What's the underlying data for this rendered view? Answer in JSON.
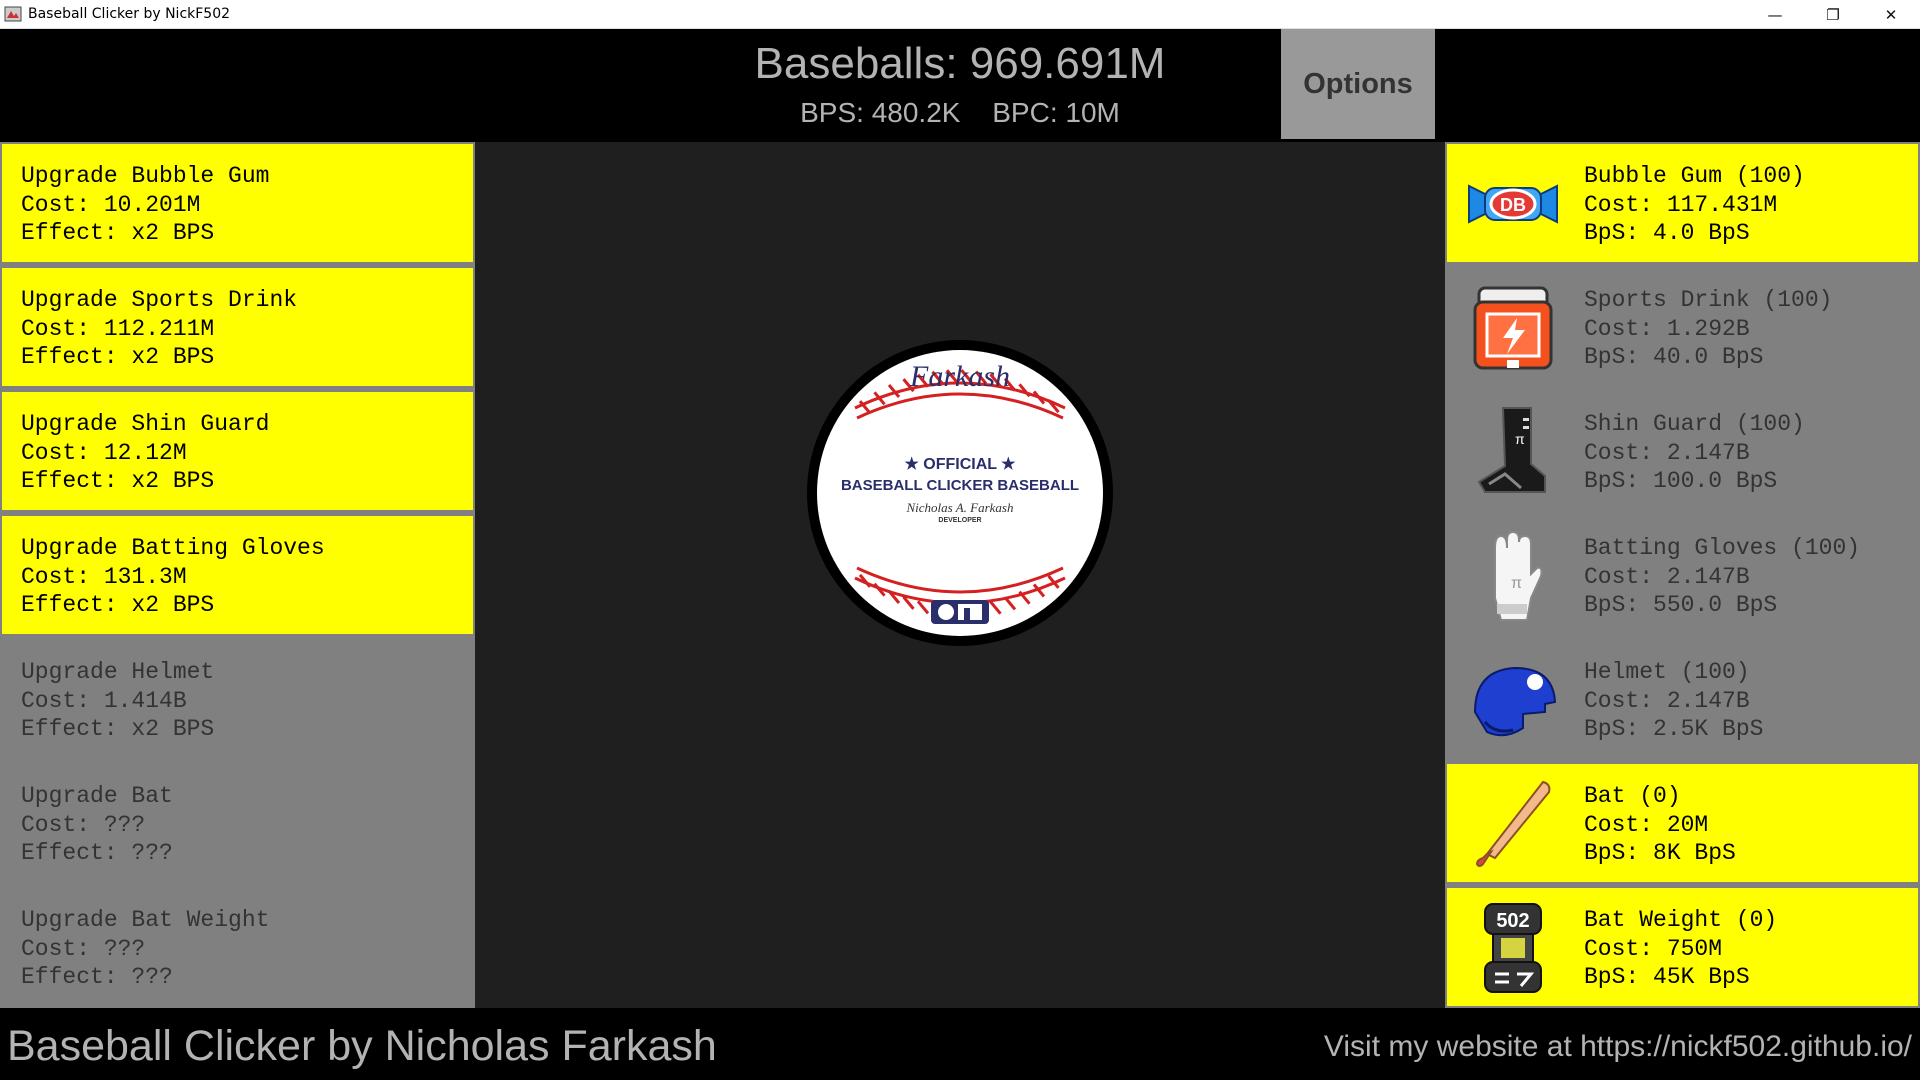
{
  "window": {
    "title": "Baseball Clicker by NickF502",
    "minimize": "—",
    "maximize": "❐",
    "close": "✕"
  },
  "header": {
    "baseballs": "Baseballs: 969.691M",
    "bps": "BPS: 480.2K",
    "bpc": "BPC: 10M",
    "options_label": "Options"
  },
  "upgrades": [
    {
      "name": "Upgrade Bubble Gum",
      "cost": "Cost: 10.201M",
      "effect": "Effect: x2 BPS",
      "affordable": true
    },
    {
      "name": "Upgrade Sports Drink",
      "cost": "Cost: 112.211M",
      "effect": "Effect: x2 BPS",
      "affordable": true
    },
    {
      "name": "Upgrade Shin Guard",
      "cost": "Cost: 12.12M",
      "effect": "Effect: x2 BPS",
      "affordable": true
    },
    {
      "name": "Upgrade Batting Gloves",
      "cost": "Cost: 131.3M",
      "effect": "Effect: x2 BPS",
      "affordable": true
    },
    {
      "name": "Upgrade Helmet",
      "cost": "Cost: 1.414B",
      "effect": "Effect: x2 BPS",
      "affordable": false
    },
    {
      "name": "Upgrade Bat",
      "cost": "Cost: ???",
      "effect": "Effect: ???",
      "affordable": false
    },
    {
      "name": "Upgrade Bat Weight",
      "cost": "Cost: ???",
      "effect": "Effect: ???",
      "affordable": false
    }
  ],
  "buildings": [
    {
      "name": "Bubble Gum (100)",
      "cost": "Cost: 117.431M",
      "bps": "BpS: 4.0 BpS",
      "affordable": true,
      "icon": "bubble-gum-icon"
    },
    {
      "name": "Sports Drink (100)",
      "cost": "Cost: 1.292B",
      "bps": "BpS: 40.0 BpS",
      "affordable": false,
      "icon": "sports-drink-icon"
    },
    {
      "name": "Shin Guard (100)",
      "cost": "Cost: 2.147B",
      "bps": "BpS: 100.0 BpS",
      "affordable": false,
      "icon": "shin-guard-icon"
    },
    {
      "name": "Batting Gloves (100)",
      "cost": "Cost: 2.147B",
      "bps": "BpS: 550.0 BpS",
      "affordable": false,
      "icon": "batting-gloves-icon"
    },
    {
      "name": "Helmet (100)",
      "cost": "Cost: 2.147B",
      "bps": "BpS: 2.5K BpS",
      "affordable": false,
      "icon": "helmet-icon"
    },
    {
      "name": "Bat (0)",
      "cost": "Cost: 20M",
      "bps": "BpS: 8K BpS",
      "affordable": true,
      "icon": "bat-icon"
    },
    {
      "name": "Bat Weight (0)",
      "cost": "Cost: 750M",
      "bps": "BpS: 45K BpS",
      "affordable": true,
      "icon": "bat-weight-icon"
    }
  ],
  "icon_text": {
    "gum": "DB",
    "weight": "502"
  },
  "baseball": {
    "brand": "Farkash",
    "official": "★ OFFICIAL ★",
    "league": "BASEBALL CLICKER BASEBALL",
    "signature": "Nicholas A. Farkash",
    "developer": "DEVELOPER"
  },
  "footer": {
    "credit": "Baseball Clicker by Nicholas Farkash",
    "website": "Visit my website at https://nickf502.github.io/"
  },
  "colors": {
    "affordable": "#ffff00",
    "unaffordable": "#808080",
    "center_bg": "#1f1f1f"
  }
}
